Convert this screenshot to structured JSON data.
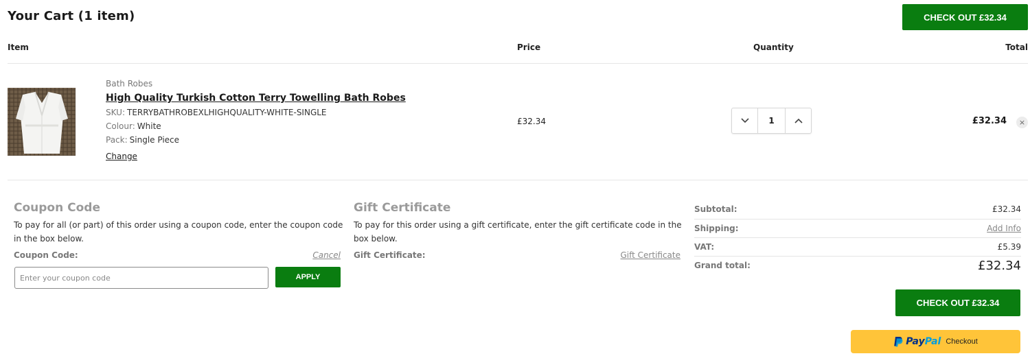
{
  "header": {
    "title": "Your Cart (1 item)",
    "checkout_label": "CHECK OUT £32.34"
  },
  "columns": {
    "item": "Item",
    "price": "Price",
    "quantity": "Quantity",
    "total": "Total"
  },
  "cart_item": {
    "brand": "Bath Robes",
    "name": "High Quality Turkish Cotton Terry Towelling Bath Robes",
    "options": [
      {
        "label": "SKU:",
        "value": "TERRYBATHROBEXLHIGHQUALITY-WHITE-SINGLE"
      },
      {
        "label": "Colour:",
        "value": "White"
      },
      {
        "label": "Pack:",
        "value": "Single Piece"
      }
    ],
    "change_label": "Change",
    "price": "£32.34",
    "quantity": "1",
    "total": "£32.34",
    "remove_glyph": "×",
    "image_icon": "bathrobe-photo"
  },
  "coupon": {
    "title": "Coupon Code",
    "description": "To pay for all (or part) of this order using a coupon code, enter the coupon code in the box below.",
    "field_label": "Coupon Code:",
    "cancel_label": "Cancel",
    "input_value": "",
    "input_placeholder": "Enter your coupon code",
    "apply_label": "APPLY"
  },
  "gift": {
    "title": "Gift Certificate",
    "description": "To pay for this order using a gift certificate, enter the gift certificate code in the box below.",
    "field_label": "Gift Certificate:",
    "link_label": "Gift Certificate"
  },
  "summary": {
    "subtotal_label": "Subtotal:",
    "subtotal_value": "£32.34",
    "shipping_label": "Shipping:",
    "shipping_value": "Add Info",
    "vat_label": "VAT:",
    "vat_value": "£5.39",
    "grand_label": "Grand total:",
    "grand_value": "£32.34"
  },
  "footer": {
    "checkout_label": "CHECK OUT £32.34",
    "paypal_pay": "Pay",
    "paypal_pal": "Pal",
    "paypal_checkout": "Checkout"
  },
  "colors": {
    "primary_green": "#0a7d10",
    "paypal_yellow": "#ffc439",
    "muted_text": "#9a9a9a"
  }
}
